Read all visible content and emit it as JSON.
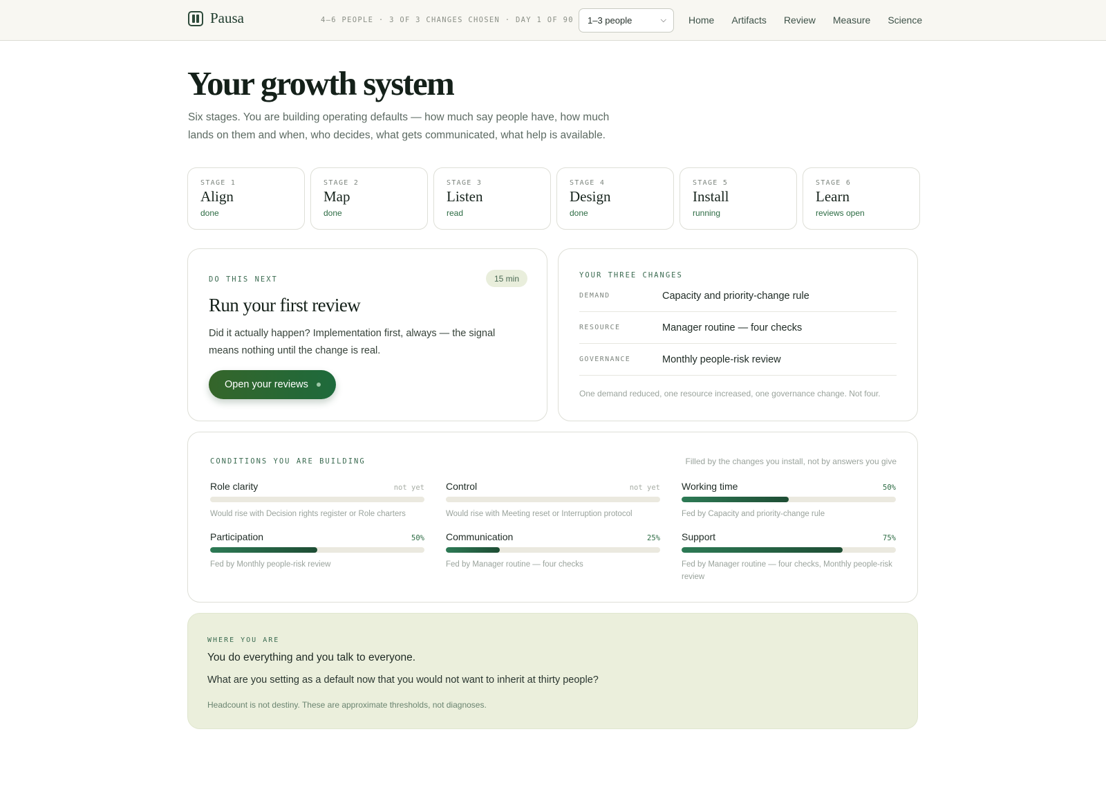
{
  "app": {
    "name": "Pausa"
  },
  "header": {
    "meta": "4–6 PEOPLE · 3 OF 3 CHANGES CHOSEN · DAY 1 OF 90",
    "team_size_select": "1–3 people",
    "nav": [
      "Home",
      "Artifacts",
      "Review",
      "Measure",
      "Science"
    ]
  },
  "page": {
    "title": "Your growth system",
    "subtitle": "Six stages. You are building operating defaults — how much say people have, how much lands on them and when, who decides, what gets communicated, what help is available."
  },
  "stages": [
    {
      "key": "STAGE 1",
      "name": "Align",
      "status": "done"
    },
    {
      "key": "STAGE 2",
      "name": "Map",
      "status": "done"
    },
    {
      "key": "STAGE 3",
      "name": "Listen",
      "status": "read"
    },
    {
      "key": "STAGE 4",
      "name": "Design",
      "status": "done"
    },
    {
      "key": "STAGE 5",
      "name": "Install",
      "status": "running"
    },
    {
      "key": "STAGE 6",
      "name": "Learn",
      "status": "reviews open"
    }
  ],
  "next": {
    "eyebrow": "DO THIS NEXT",
    "duration": "15 min",
    "title": "Run your first review",
    "body": "Did it actually happen? Implementation first, always — the signal means nothing until the change is real.",
    "button": "Open your reviews"
  },
  "changes": {
    "eyebrow": "YOUR THREE CHANGES",
    "rows": [
      {
        "key": "DEMAND",
        "value": "Capacity and priority-change rule"
      },
      {
        "key": "RESOURCE",
        "value": "Manager routine — four checks"
      },
      {
        "key": "GOVERNANCE",
        "value": "Monthly people-risk review"
      }
    ],
    "note": "One demand reduced, one resource increased, one governance change. Not four."
  },
  "conditions": {
    "eyebrow": "CONDITIONS YOU ARE BUILDING",
    "note": "Filled by the changes you install, not by answers you give",
    "items": [
      {
        "label": "Role clarity",
        "value": "not yet",
        "percent": 0,
        "sub": "Would rise with Decision rights register or Role charters"
      },
      {
        "label": "Control",
        "value": "not yet",
        "percent": 0,
        "sub": "Would rise with Meeting reset or Interruption protocol"
      },
      {
        "label": "Working time",
        "value": "50%",
        "percent": 50,
        "sub": "Fed by Capacity and priority-change rule"
      },
      {
        "label": "Participation",
        "value": "50%",
        "percent": 50,
        "sub": "Fed by Monthly people-risk review"
      },
      {
        "label": "Communication",
        "value": "25%",
        "percent": 25,
        "sub": "Fed by Manager routine — four checks"
      },
      {
        "label": "Support",
        "value": "75%",
        "percent": 75,
        "sub": "Fed by Manager routine — four checks, Monthly people-risk review"
      }
    ]
  },
  "where": {
    "eyebrow": "WHERE YOU ARE",
    "line1": "You do everything and you talk to everyone.",
    "line2": "What are you setting as a default now that you would not want to inherit at thirty people?",
    "note": "Headcount is not destiny. These are approximate thresholds, not diagnoses."
  }
}
